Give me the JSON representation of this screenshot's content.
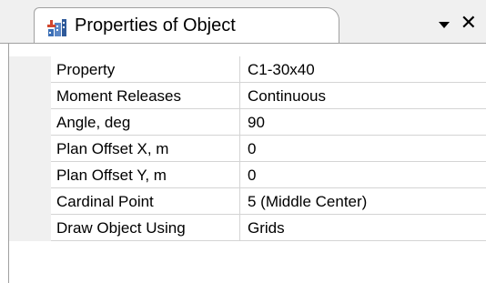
{
  "window": {
    "title": "Properties of Object",
    "icon": "building-grid-icon"
  },
  "controls": {
    "dropdown_icon": "chevron-down-icon",
    "close_label": "✕"
  },
  "properties": [
    {
      "name": "Property",
      "value": "C1-30x40"
    },
    {
      "name": "Moment Releases",
      "value": "Continuous"
    },
    {
      "name": "Angle, deg",
      "value": "90"
    },
    {
      "name": "Plan Offset X, m",
      "value": "0"
    },
    {
      "name": "Plan Offset Y, m",
      "value": "0"
    },
    {
      "name": "Cardinal Point",
      "value": "5 (Middle Center)"
    },
    {
      "name": "Draw Object Using",
      "value": "Grids"
    }
  ]
}
